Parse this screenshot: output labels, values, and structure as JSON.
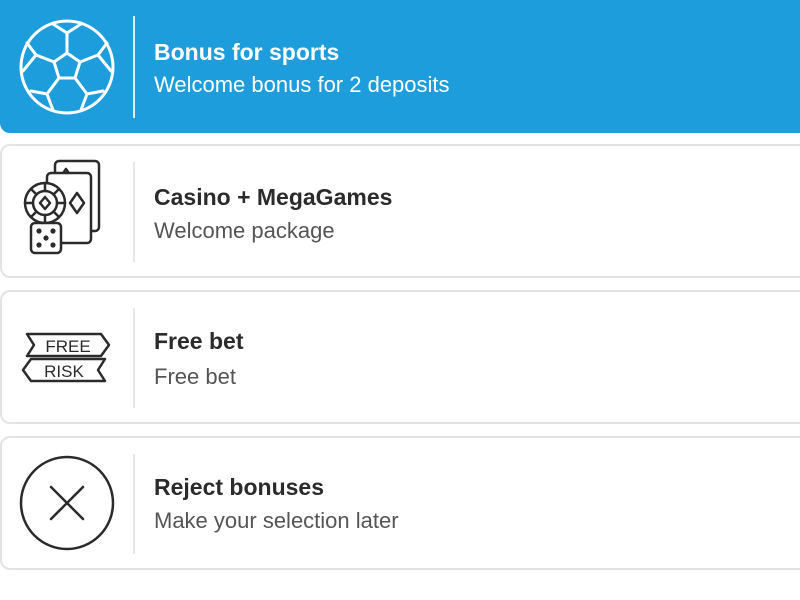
{
  "options": [
    {
      "title": "Bonus for sports",
      "subtitle": "Welcome bonus for 2 deposits",
      "icon": "soccer-ball-icon",
      "selected": true
    },
    {
      "title": "Casino + MegaGames",
      "subtitle": "Welcome package",
      "icon": "casino-chips-cards-dice-icon",
      "selected": false
    },
    {
      "title": "Free bet",
      "subtitle": "Free bet",
      "icon": "free-risk-ticket-icon",
      "selected": false,
      "icon_text": {
        "top": "FREE",
        "bottom": "RISK"
      }
    },
    {
      "title": "Reject bonuses",
      "subtitle": "Make your selection later",
      "icon": "reject-x-icon",
      "selected": false
    }
  ],
  "colors": {
    "accent": "#1e9ddc",
    "border": "#e3e3e3",
    "title": "#2b2b2b",
    "subtitle": "#555555"
  }
}
